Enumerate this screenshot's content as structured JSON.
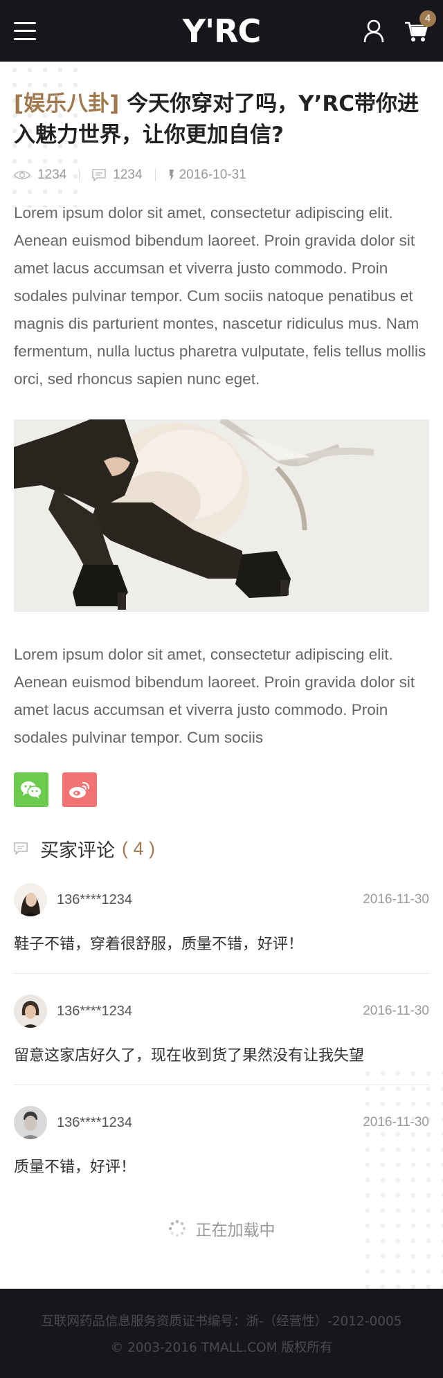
{
  "header": {
    "logo": "Y'RC",
    "cart_count": "4"
  },
  "article": {
    "tag": "[娱乐八卦]",
    "title": " 今天你穿对了吗，Y’RC带你进入魅力世界，让你更加自信?",
    "views": "1234",
    "comments": "1234",
    "date": "2016-10-31",
    "paragraph1": "Lorem ipsum dolor sit amet, consectetur adipiscing elit. Aenean euismod bibendum laoreet. Proin gravida dolor sit amet lacus accumsan et viverra justo commodo. Proin sodales pulvinar tempor. Cum sociis natoque penatibus et magnis dis parturient montes, nascetur ridiculus mus. Nam fermentum, nulla luctus pharetra vulputate, felis tellus mollis orci, sed rhoncus sapien nunc eget.",
    "paragraph2": "Lorem ipsum dolor sit amet, consectetur adipiscing elit. Aenean euismod bibendum laoreet. Proin gravida dolor sit amet lacus accumsan et viverra justo commodo. Proin sodales pulvinar tempor. Cum sociis"
  },
  "share": {
    "wechat_icon": "wechat-icon",
    "weibo_icon": "weibo-icon"
  },
  "reviews": {
    "title": "买家评论",
    "count": "( 4 )",
    "items": [
      {
        "user": "136****1234",
        "date": "2016-11-30",
        "text": "鞋子不错，穿着很舒服，质量不错，好评！"
      },
      {
        "user": "136****1234",
        "date": "2016-11-30",
        "text": "留意这家店好久了，现在收到货了果然没有让我失望"
      },
      {
        "user": "136****1234",
        "date": "2016-11-30",
        "text": "质量不错，好评！"
      }
    ],
    "loading": "正在加载中"
  },
  "footer": {
    "license": "互联网药品信息服务资质证书编号：浙-（经营性）-2012-0005",
    "copyright": "© 2003-2016 TMALL.COM 版权所有"
  },
  "colors": {
    "header_bg": "#16171c",
    "accent": "#a07a4e",
    "wechat": "#6bcb4c",
    "weibo": "#f27372"
  }
}
